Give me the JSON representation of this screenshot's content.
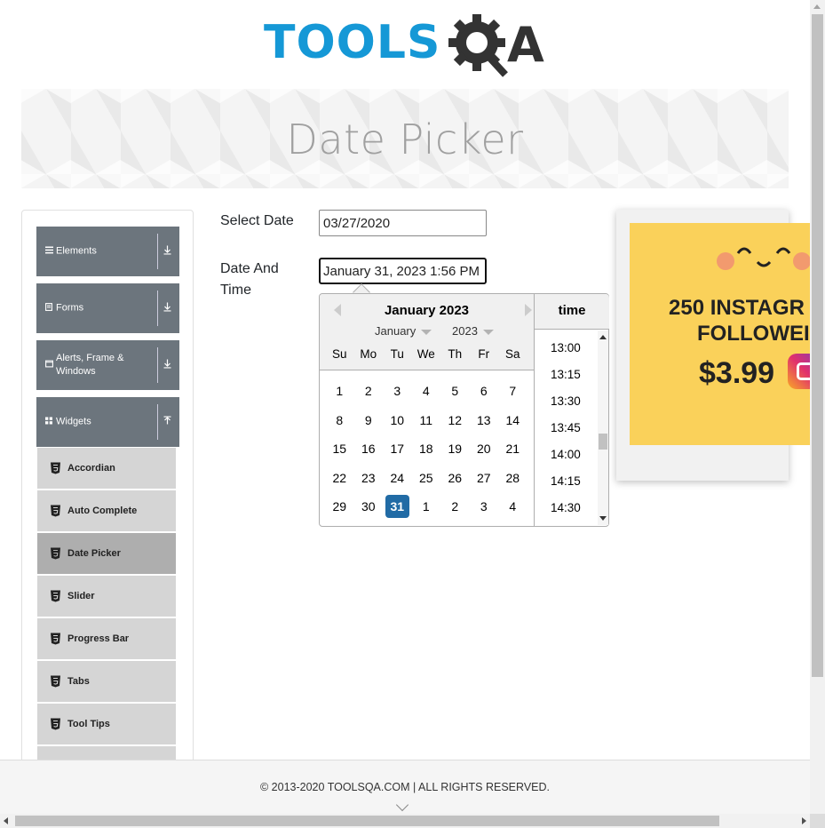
{
  "header": {
    "logo_text": "TOOLS",
    "logo_suffix": "A",
    "page_title": "Date Picker"
  },
  "sidebar": {
    "groups": [
      {
        "label": "Elements",
        "icon": "hamburger-icon",
        "arrow": "download-icon"
      },
      {
        "label": "Forms",
        "icon": "document-icon",
        "arrow": "download-icon"
      },
      {
        "label": "Alerts, Frame & Windows",
        "icon": "window-icon",
        "arrow": "download-icon"
      },
      {
        "label": "Widgets",
        "icon": "grid-icon",
        "arrow": "upload-icon"
      }
    ],
    "widget_items": [
      {
        "label": "Accordian",
        "active": false
      },
      {
        "label": "Auto Complete",
        "active": false
      },
      {
        "label": "Date Picker",
        "active": true
      },
      {
        "label": "Slider",
        "active": false
      },
      {
        "label": "Progress Bar",
        "active": false
      },
      {
        "label": "Tabs",
        "active": false
      },
      {
        "label": "Tool Tips",
        "active": false
      }
    ]
  },
  "form": {
    "select_date_label": "Select Date",
    "select_date_value": "03/27/2020",
    "date_time_label": "Date And Time",
    "date_time_value": "January 31, 2023 1:56 PM"
  },
  "picker": {
    "current_month": "January 2023",
    "month_dropdown": "January",
    "year_dropdown": "2023",
    "weekdays": [
      "Su",
      "Mo",
      "Tu",
      "We",
      "Th",
      "Fr",
      "Sa"
    ],
    "weeks": [
      [
        "1",
        "2",
        "3",
        "4",
        "5",
        "6",
        "7"
      ],
      [
        "8",
        "9",
        "10",
        "11",
        "12",
        "13",
        "14"
      ],
      [
        "15",
        "16",
        "17",
        "18",
        "19",
        "20",
        "21"
      ],
      [
        "22",
        "23",
        "24",
        "25",
        "26",
        "27",
        "28"
      ],
      [
        "29",
        "30",
        "31",
        "1",
        "2",
        "3",
        "4"
      ]
    ],
    "selected_day": "31",
    "time_header": "time",
    "times": [
      "13:00",
      "13:15",
      "13:30",
      "13:45",
      "14:00",
      "14:15",
      "14:30"
    ],
    "selected_color": "#216ba5"
  },
  "ad": {
    "line1": "250 INSTAGR",
    "line2": "FOLLOWEI",
    "price": "$3.99",
    "background": "#fad15a"
  },
  "footer": {
    "copyright": "© 2013-2020 TOOLSQA.COM | ALL RIGHTS RESERVED."
  },
  "colors": {
    "brand_blue": "#1598d6",
    "sidebar_group": "#6c757d",
    "sidebar_item": "#d5d5d5",
    "sidebar_item_active": "#aeaeae"
  }
}
